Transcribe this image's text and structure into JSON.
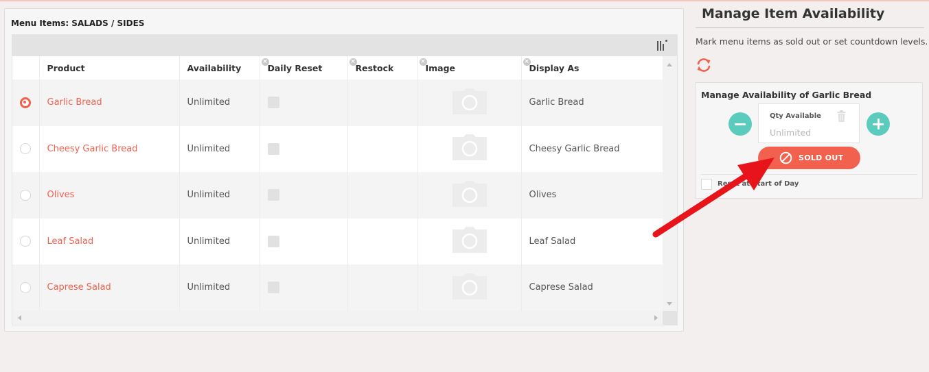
{
  "left_panel": {
    "title": "Menu Items: SALADS / SIDES",
    "columns": [
      {
        "label": "Product",
        "removable": false
      },
      {
        "label": "Availability",
        "removable": false
      },
      {
        "label": "Daily Reset",
        "removable": true
      },
      {
        "label": "Restock",
        "removable": true
      },
      {
        "label": "Image",
        "removable": true
      },
      {
        "label": "Display As",
        "removable": true
      }
    ],
    "rows": [
      {
        "product": "Garlic Bread",
        "availability": "Unlimited",
        "restock": "",
        "display_as": "Garlic Bread",
        "selected": true
      },
      {
        "product": "Cheesy Garlic Bread",
        "availability": "Unlimited",
        "restock": "",
        "display_as": "Cheesy Garlic Bread",
        "selected": false
      },
      {
        "product": "Olives",
        "availability": "Unlimited",
        "restock": "",
        "display_as": "Olives",
        "selected": false
      },
      {
        "product": "Leaf Salad",
        "availability": "Unlimited",
        "restock": "",
        "display_as": "Leaf Salad",
        "selected": false
      },
      {
        "product": "Caprese Salad",
        "availability": "Unlimited",
        "restock": "",
        "display_as": "Caprese Salad",
        "selected": false
      }
    ]
  },
  "right_panel": {
    "title": "Manage Item Availability",
    "description": "Mark menu items as sold out or set countdown levels.",
    "card": {
      "title": "Manage Availability of Garlic Bread",
      "qty_label": "Qty Available",
      "qty_placeholder": "Unlimited",
      "sold_out_label": "SOLD OUT",
      "reset_label": "Reset at Start of Day"
    }
  },
  "icons": {
    "refresh": "refresh-icon",
    "trash": "trash-icon",
    "ban": "ban-icon",
    "camera": "camera-icon",
    "column_chooser": "column-chooser-icon"
  },
  "colors": {
    "accent": "#f1614d",
    "teal": "#5bcbbd",
    "annotation_arrow": "#e8141b"
  }
}
